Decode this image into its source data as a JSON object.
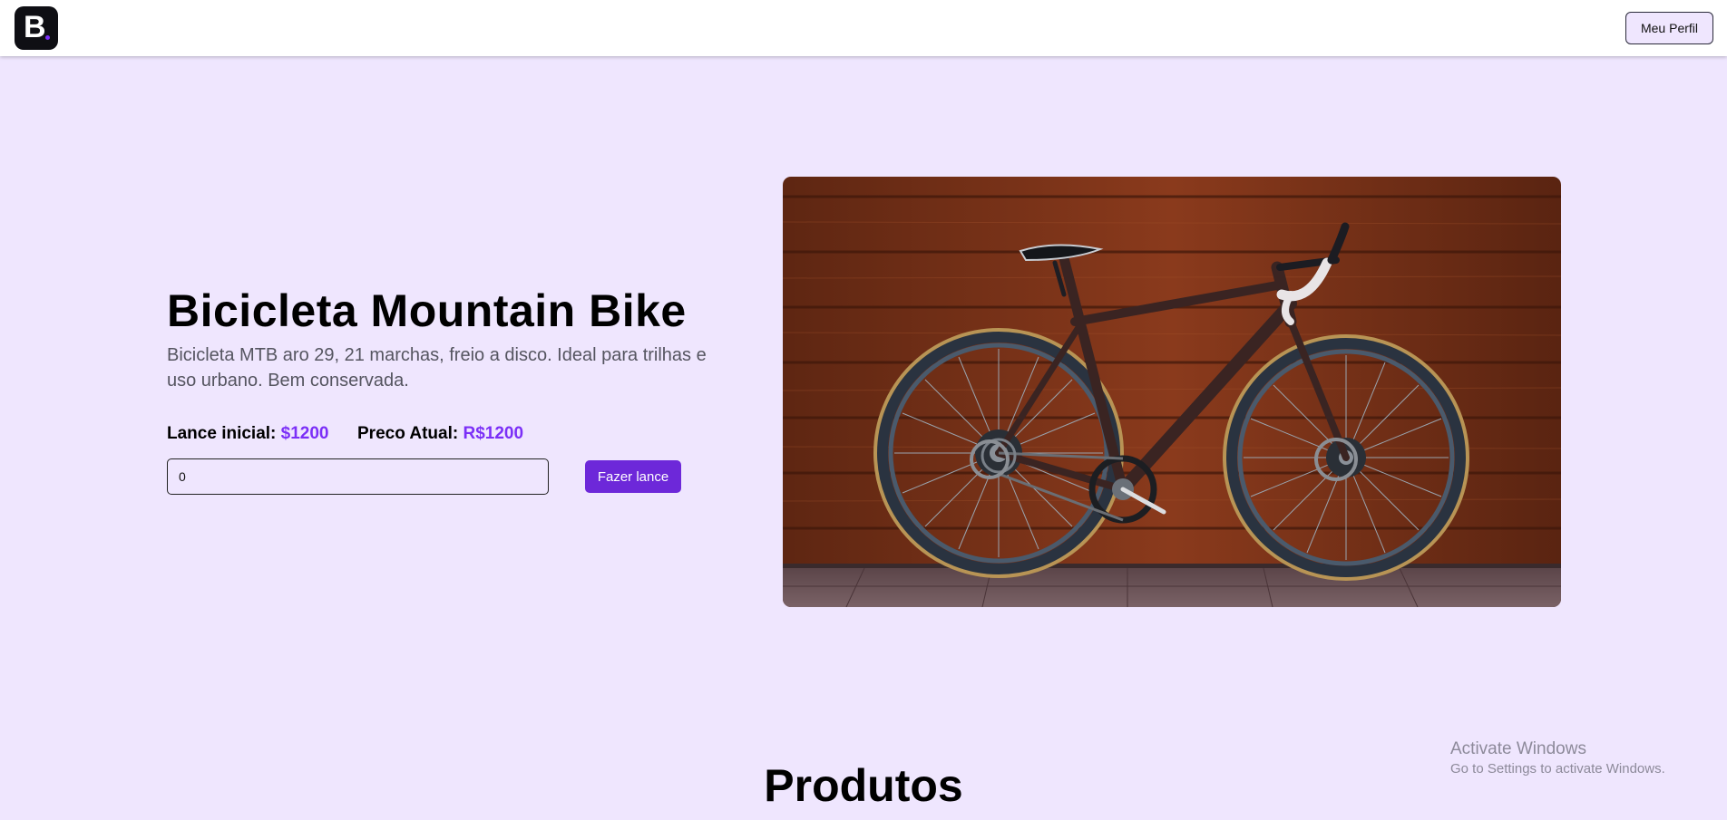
{
  "navbar": {
    "logo_letter": "B",
    "profile_button": "Meu Perfil"
  },
  "auction": {
    "title": "Bicicleta Mountain Bike",
    "description": "Bicicleta MTB aro 29, 21 marchas, freio a disco. Ideal para trilhas e uso urbano. Bem conservada.",
    "initial_bid_label": "Lance inicial:",
    "initial_bid_value": "$1200",
    "current_price_label": "Preco Atual:",
    "current_price_value": "R$1200",
    "bid_input_value": "0",
    "bid_button": "Fazer lance"
  },
  "products": {
    "title": "Produtos"
  },
  "watermark": {
    "title": "Activate Windows",
    "subtitle": "Go to Settings to activate Windows."
  },
  "colors": {
    "page_background": "#efe6fe",
    "accent": "#7b2ff7",
    "button": "#6d28d9"
  }
}
